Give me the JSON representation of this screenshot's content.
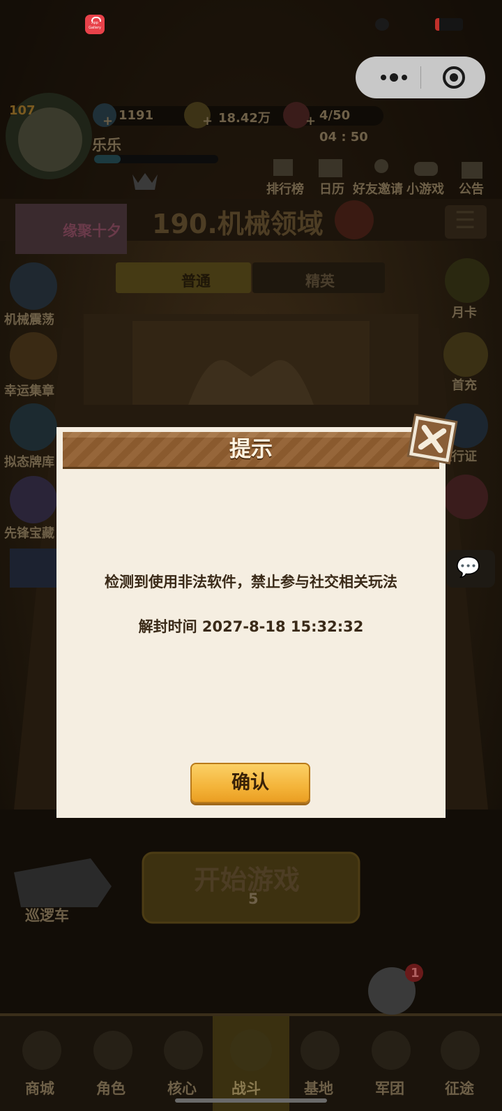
{
  "status_bar": {
    "app_icon_label": "App Gallery"
  },
  "capsule": {
    "more_icon": "more-dots-icon",
    "close_icon": "target-circle-icon"
  },
  "player": {
    "level": "107",
    "name": "乐乐"
  },
  "resources": {
    "gems": "1191",
    "gold": "18.42万",
    "stamina": "4/50",
    "stamina_timer": "04 : 50"
  },
  "top_menu": [
    {
      "label": "排行榜",
      "icon": "ranking-icon"
    },
    {
      "label": "日历",
      "icon": "calendar-icon"
    },
    {
      "label": "好友邀请",
      "icon": "friend-invite-icon"
    },
    {
      "label": "小游戏",
      "icon": "gamepad-icon"
    },
    {
      "label": "公告",
      "icon": "announcement-icon"
    }
  ],
  "event_banner": {
    "text": "缘聚十夕"
  },
  "stage": {
    "title": "190.机械领域",
    "tab_normal": "普通",
    "tab_elite": "精英"
  },
  "left_menu": [
    {
      "label": "机械震荡"
    },
    {
      "label": "幸运集章"
    },
    {
      "label": "拟态牌库"
    },
    {
      "label": "先锋宝藏"
    }
  ],
  "right_menu": [
    {
      "label": "月卡"
    },
    {
      "label": "首充"
    },
    {
      "label": "通行证"
    }
  ],
  "patrol_car": {
    "label": "巡逻车"
  },
  "start_game": {
    "label": "开始游戏",
    "cost": "5"
  },
  "bottom_nav": [
    {
      "label": "商城"
    },
    {
      "label": "角色"
    },
    {
      "label": "核心"
    },
    {
      "label": "战斗"
    },
    {
      "label": "基地"
    },
    {
      "label": "军团"
    },
    {
      "label": "征途"
    }
  ],
  "team_badge": "1",
  "dialog": {
    "title": "提示",
    "message": "检测到使用非法软件，禁止参与社交相关玩法",
    "unban_time": "解封时间 2027-8-18 15:32:32",
    "confirm_label": "确认"
  }
}
